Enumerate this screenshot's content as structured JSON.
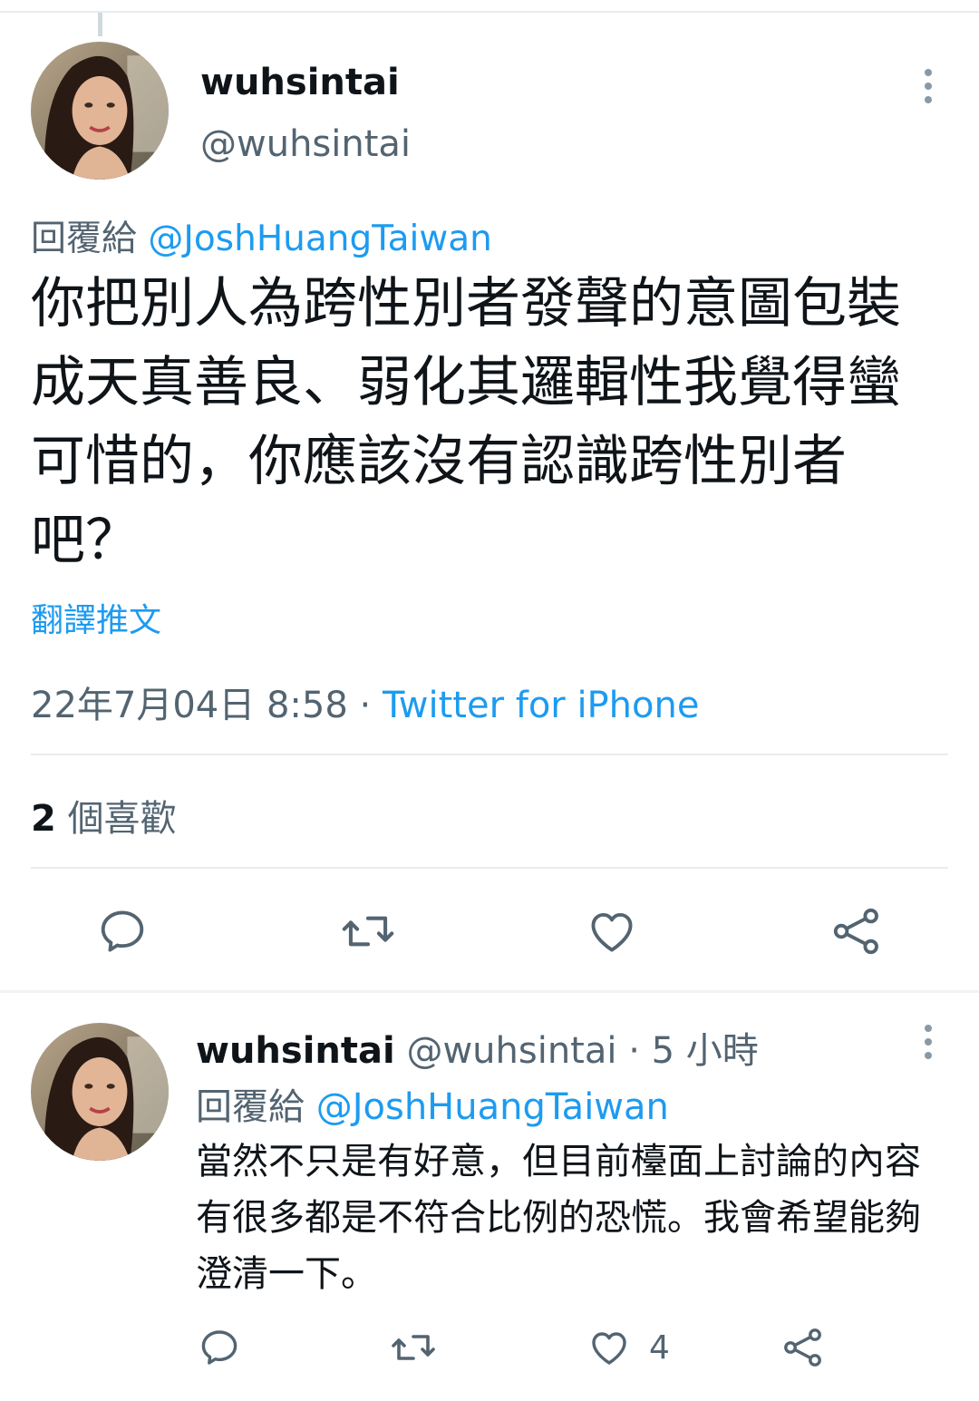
{
  "main_tweet": {
    "display_name": "wuhsintai",
    "handle": "@wuhsintai",
    "reply_prefix": "回覆給",
    "reply_mention": "@JoshHuangTaiwan",
    "text": "你把別人為跨性別者發聲的意圖包裝成天真善良、弱化其邏輯性我覺得蠻可惜的，你應該沒有認識跨性別者吧？",
    "translate_label": "翻譯推文",
    "timestamp": "22年7月04日 8:58",
    "separator": "·",
    "source": "Twitter for iPhone",
    "likes_count": "2",
    "likes_label": "個喜歡"
  },
  "icons": {
    "reply": "reply-icon",
    "retweet": "retweet-icon",
    "like": "heart-icon",
    "share": "share-icon",
    "more": "more-vertical-icon"
  },
  "reply_tweet": {
    "display_name": "wuhsintai",
    "handle": "@wuhsintai",
    "separator": "·",
    "time_ago": "5 小時",
    "reply_prefix": "回覆給",
    "reply_mention": "@JoshHuangTaiwan",
    "text": "當然不只是有好意，但目前檯面上討論的內容有很多都是不符合比例的恐慌。我會希望能夠澄清一下。",
    "like_count": "4"
  },
  "colors": {
    "accent": "#1d9bf0",
    "secondary_text": "#536471",
    "primary_text": "#0f1419",
    "divider": "#e7ecef"
  }
}
